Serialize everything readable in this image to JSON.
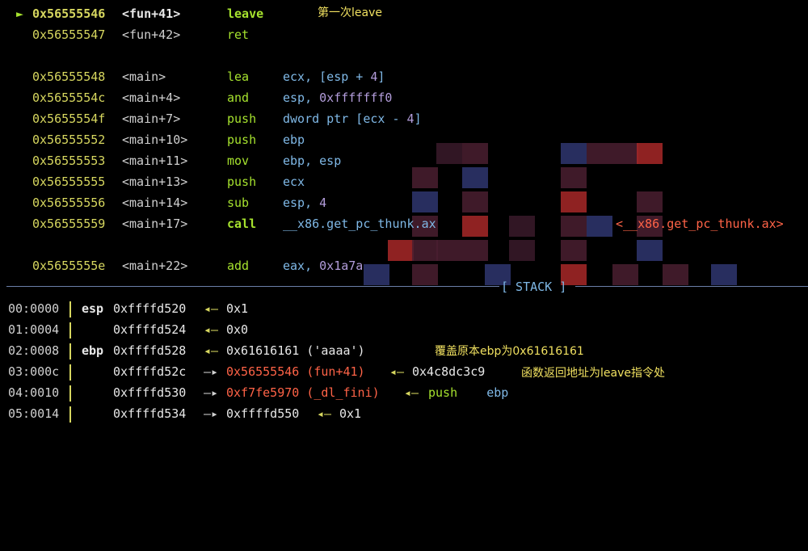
{
  "disasm": [
    {
      "current": true,
      "marker": "►",
      "addr": "0x56555546",
      "func": "<fun+41>",
      "mnem": "leave",
      "operands": "",
      "note": "第一次leave"
    },
    {
      "current": false,
      "marker": "",
      "addr": "0x56555547",
      "func": "<fun+42>",
      "mnem": "ret",
      "operands": ""
    },
    {
      "current": false,
      "marker": "",
      "addr": "0x56555548",
      "func": "<main>",
      "mnem": "lea",
      "operands": "ecx, [esp + 4]"
    },
    {
      "current": false,
      "marker": "",
      "addr": "0x5655554c",
      "func": "<main+4>",
      "mnem": "and",
      "operands": "esp, 0xfffffff0"
    },
    {
      "current": false,
      "marker": "",
      "addr": "0x5655554f",
      "func": "<main+7>",
      "mnem": "push",
      "operands": "dword ptr [ecx - 4]"
    },
    {
      "current": false,
      "marker": "",
      "addr": "0x56555552",
      "func": "<main+10>",
      "mnem": "push",
      "operands": "ebp"
    },
    {
      "current": false,
      "marker": "",
      "addr": "0x56555553",
      "func": "<main+11>",
      "mnem": "mov",
      "operands": "ebp, esp"
    },
    {
      "current": false,
      "marker": "",
      "addr": "0x56555555",
      "func": "<main+13>",
      "mnem": "push",
      "operands": "ecx"
    },
    {
      "current": false,
      "marker": "",
      "addr": "0x56555556",
      "func": "<main+14>",
      "mnem": "sub",
      "operands": "esp, 4"
    },
    {
      "current": false,
      "marker": "",
      "addr": "0x56555559",
      "func": "<main+17>",
      "mnem": "call",
      "operands": "__x86.get_pc_thunk.ax",
      "target": "<__x86.get_pc_thunk.ax>"
    },
    {
      "current": false,
      "marker": "",
      "addr": "0x5655555e",
      "func": "<main+22>",
      "mnem": "add",
      "operands": "eax, 0x1a7a"
    }
  ],
  "stack_header": "[ STACK ]",
  "stack": [
    {
      "idx": "00:0000",
      "reg": "esp",
      "addr": "0xffffd520",
      "arrow": "◂—",
      "value": "0x1"
    },
    {
      "idx": "01:0004",
      "reg": "",
      "addr": "0xffffd524",
      "arrow": "◂—",
      "value": "0x0"
    },
    {
      "idx": "02:0008",
      "reg": "ebp",
      "addr": "0xffffd528",
      "arrow": "◂—",
      "value": "0x61616161 ('aaaa')",
      "note": "覆盖原本ebp为0x61616161"
    },
    {
      "idx": "03:000c",
      "reg": "",
      "addr": "0xffffd52c",
      "arrow": "—▸",
      "ptr": "0x56555546 (fun+41)",
      "arrow2": "◂—",
      "value2": "0x4c8dc3c9",
      "note": "函数返回地址为leave指令处"
    },
    {
      "idx": "04:0010",
      "reg": "",
      "addr": "0xffffd530",
      "arrow": "—▸",
      "ptr": "0xf7fe5970 (_dl_fini)",
      "arrow2": "◂—",
      "value2": "push    ebp"
    },
    {
      "idx": "05:0014",
      "reg": "",
      "addr": "0xffffd534",
      "arrow": "—▸",
      "value": "0xffffd550",
      "arrow2": "◂—",
      "value2": "0x1"
    }
  ],
  "colors": {
    "background": "#000000",
    "address": "#d7d75f",
    "mnemonic": "#a6e22e",
    "operand": "#7fb8e6",
    "immediate": "#b39ddb",
    "code_pointer": "#ff6347",
    "annotation": "#f0e060"
  }
}
